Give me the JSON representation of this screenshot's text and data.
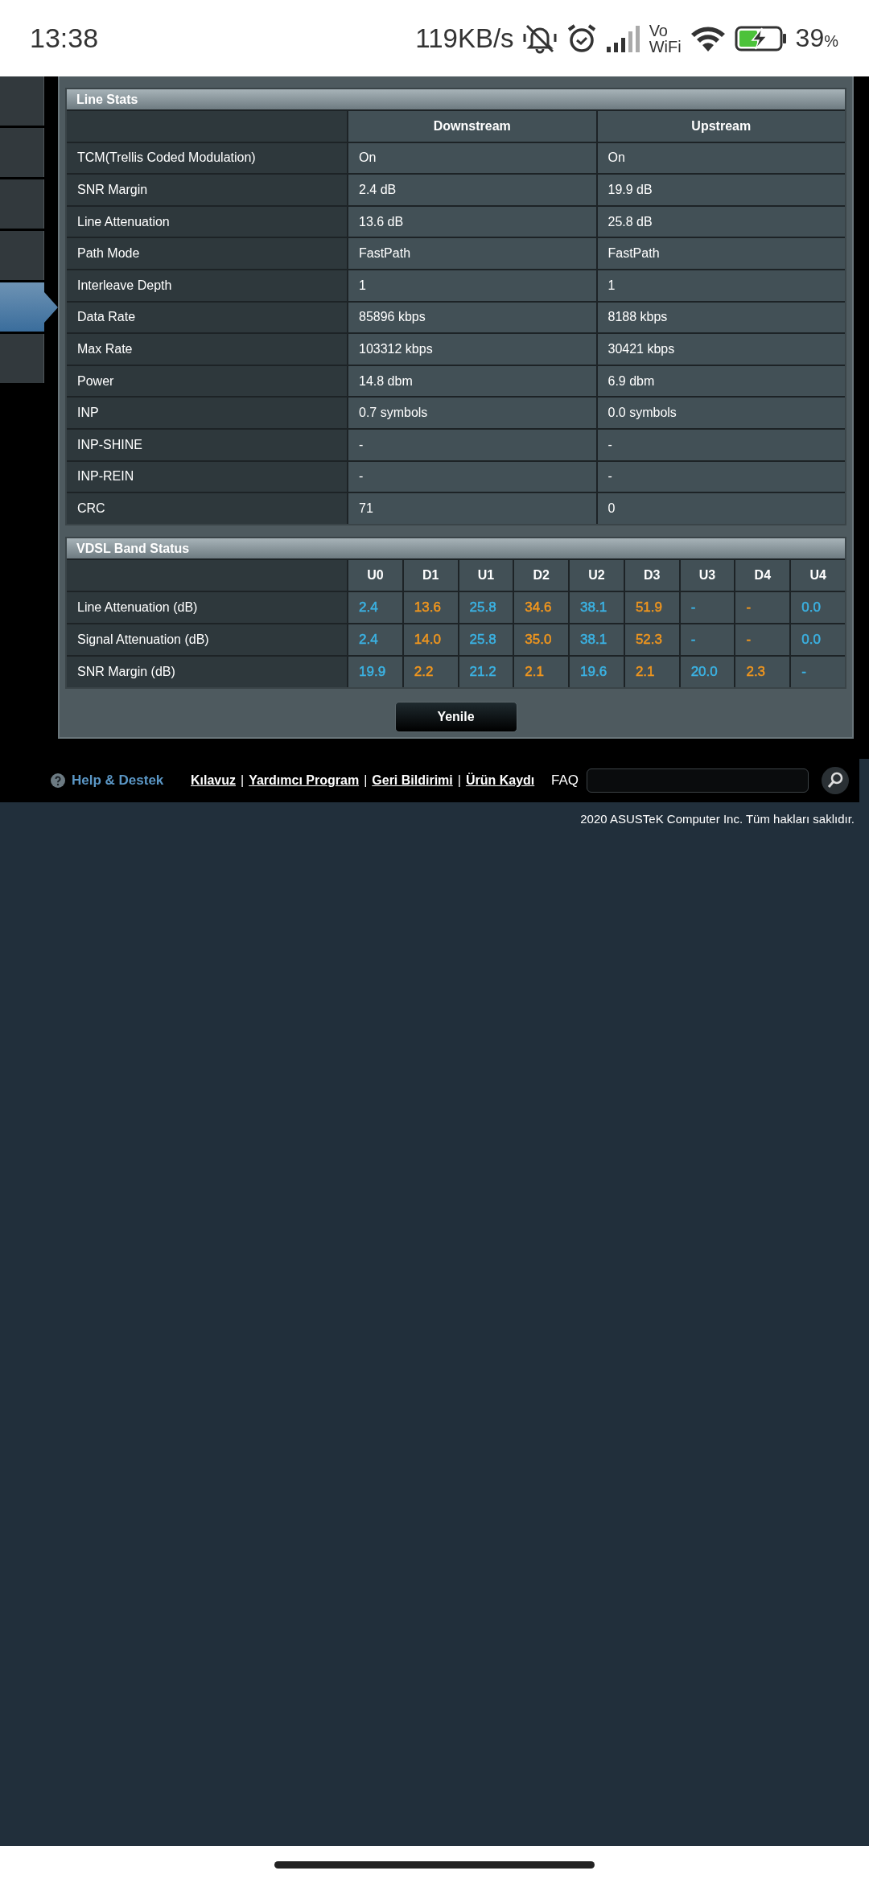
{
  "status_bar": {
    "time": "13:38",
    "net_speed": "119KB/s",
    "vowifi_top": "Vo",
    "vowifi_bottom": "WiFi",
    "battery_level_text": "39",
    "battery_unit": "%"
  },
  "sidebar": {
    "items": [
      {
        "selected": false
      },
      {
        "selected": false
      },
      {
        "selected": false
      },
      {
        "selected": false
      },
      {
        "selected": true
      },
      {
        "selected": false
      }
    ]
  },
  "line_stats": {
    "title": "Line Stats",
    "columns": [
      "Downstream",
      "Upstream"
    ],
    "rows": [
      {
        "label": "TCM(Trellis Coded Modulation)",
        "downstream": "On",
        "upstream": "On"
      },
      {
        "label": "SNR Margin",
        "downstream": "2.4 dB",
        "upstream": "19.9 dB"
      },
      {
        "label": "Line Attenuation",
        "downstream": "13.6 dB",
        "upstream": "25.8 dB"
      },
      {
        "label": "Path Mode",
        "downstream": "FastPath",
        "upstream": "FastPath"
      },
      {
        "label": "Interleave Depth",
        "downstream": "1",
        "upstream": "1"
      },
      {
        "label": "Data Rate",
        "downstream": "85896 kbps",
        "upstream": "8188 kbps"
      },
      {
        "label": "Max Rate",
        "downstream": "103312 kbps",
        "upstream": "30421 kbps"
      },
      {
        "label": "Power",
        "downstream": "14.8 dbm",
        "upstream": "6.9 dbm"
      },
      {
        "label": "INP",
        "downstream": "0.7 symbols",
        "upstream": "0.0 symbols"
      },
      {
        "label": "INP-SHINE",
        "downstream": "-",
        "upstream": "-"
      },
      {
        "label": "INP-REIN",
        "downstream": "-",
        "upstream": "-"
      },
      {
        "label": "CRC",
        "downstream": "71",
        "upstream": "0"
      }
    ]
  },
  "vdsl_band_status": {
    "title": "VDSL Band Status",
    "columns": [
      {
        "label": "U0",
        "color": "#3bb3e4"
      },
      {
        "label": "D1",
        "color": "#f0961e"
      },
      {
        "label": "U1",
        "color": "#3bb3e4"
      },
      {
        "label": "D2",
        "color": "#f0961e"
      },
      {
        "label": "U2",
        "color": "#3bb3e4"
      },
      {
        "label": "D3",
        "color": "#f0961e"
      },
      {
        "label": "U3",
        "color": "#3bb3e4"
      },
      {
        "label": "D4",
        "color": "#f0961e"
      },
      {
        "label": "U4",
        "color": "#3bb3e4"
      }
    ],
    "rows": [
      {
        "label": "Line Attenuation (dB)",
        "values": [
          "2.4",
          "13.6",
          "25.8",
          "34.6",
          "38.1",
          "51.9",
          "-",
          "-",
          "0.0"
        ]
      },
      {
        "label": "Signal Attenuation (dB)",
        "values": [
          "2.4",
          "14.0",
          "25.8",
          "35.0",
          "38.1",
          "52.3",
          "-",
          "-",
          "0.0"
        ]
      },
      {
        "label": "SNR Margin (dB)",
        "values": [
          "19.9",
          "2.2",
          "21.2",
          "2.1",
          "19.6",
          "2.1",
          "20.0",
          "2.3",
          "-"
        ]
      }
    ]
  },
  "refresh_button": "Yenile",
  "footer": {
    "help": "Help & Destek",
    "items": [
      {
        "kind": "link",
        "text": "Kılavuz"
      },
      {
        "kind": "separator",
        "text": "|"
      },
      {
        "kind": "link",
        "text": "Yardımcı Program"
      },
      {
        "kind": "separator",
        "text": "|"
      },
      {
        "kind": "link",
        "text": "Geri Bildirimi"
      },
      {
        "kind": "separator",
        "text": "|"
      },
      {
        "kind": "link",
        "text": "Ürün Kaydı"
      }
    ],
    "faq_label": "FAQ"
  },
  "copyright": "2020 ASUSTeK Computer Inc. Tüm hakları saklıdır."
}
